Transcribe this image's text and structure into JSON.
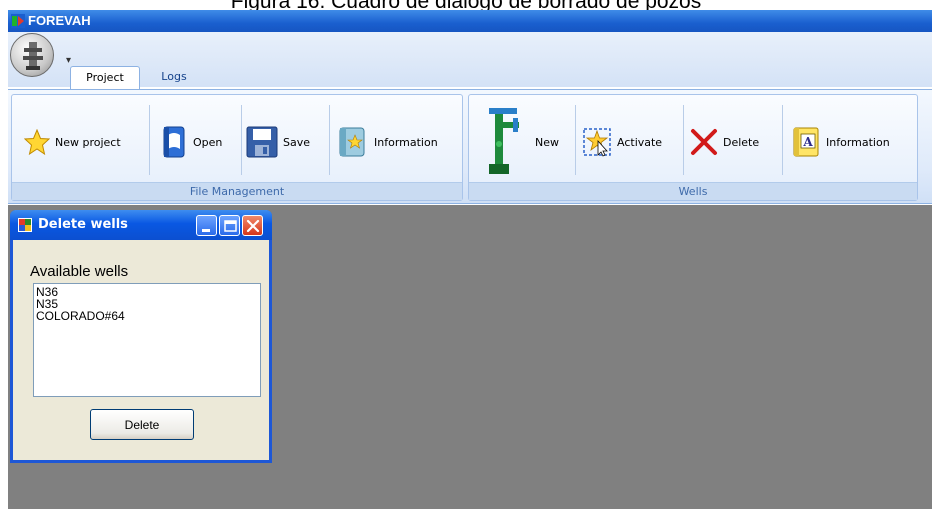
{
  "caption": "Figura 16. Cuadro de diálogo de borrado de pozos",
  "app": {
    "title": "FOREVAH"
  },
  "quick_access": {
    "arrow": "▾"
  },
  "tabs": [
    {
      "label": "Project",
      "active": true
    },
    {
      "label": "Logs",
      "active": false
    }
  ],
  "ribbon": {
    "file_management": {
      "label": "File Management",
      "buttons": {
        "new_project": "New project",
        "open": "Open",
        "save": "Save",
        "information": "Information"
      }
    },
    "wells": {
      "label": "Wells",
      "buttons": {
        "new": "New",
        "activate": "Activate",
        "delete": "Delete",
        "information": "Information"
      }
    }
  },
  "dialog": {
    "title": "Delete wells",
    "list_label": "Available wells",
    "wells": [
      "N36",
      "N35",
      "COLORADO#64"
    ],
    "delete_button": "Delete"
  },
  "colors": {
    "title_bar": "#1a5fcf",
    "dialog_title": "#0a58e3",
    "workspace": "#808080",
    "ribbon": "#dfeafa"
  },
  "icons": {
    "app": "forevah-logo-icon",
    "orb": "application-orb-icon",
    "new_project": "star-icon",
    "open": "open-book-icon",
    "save": "floppy-disk-icon",
    "information": "info-book-icon",
    "new_well": "well-tree-icon",
    "activate": "activate-star-cursor-icon",
    "delete": "red-x-icon",
    "wells_information": "yellow-book-a-icon"
  }
}
